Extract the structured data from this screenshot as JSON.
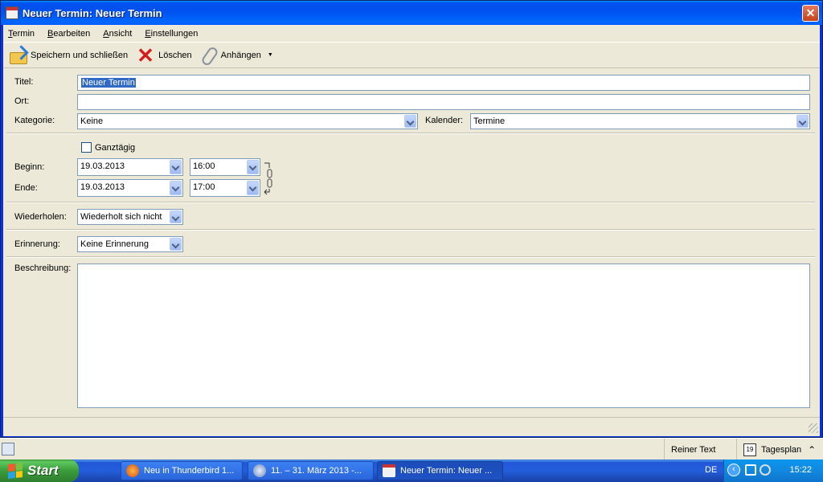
{
  "window": {
    "title": "Neuer Termin: Neuer Termin",
    "close_label": "✕"
  },
  "menu": [
    "Termin",
    "Bearbeiten",
    "Ansicht",
    "Einstellungen"
  ],
  "toolbar": {
    "save_label": "Speichern und schließen",
    "delete_label": "Löschen",
    "attach_label": "Anhängen"
  },
  "form": {
    "title_label": "Titel:",
    "title_value": "Neuer Termin",
    "location_label": "Ort:",
    "location_value": "",
    "category_label": "Kategorie:",
    "category_value": "Keine",
    "calendar_label": "Kalender:",
    "calendar_value": "Termine",
    "allday_label": "Ganztägig",
    "allday_checked": false,
    "start_label": "Beginn:",
    "start_date": "19.03.2013",
    "start_time": "16:00",
    "end_label": "Ende:",
    "end_date": "19.03.2013",
    "end_time": "17:00",
    "repeat_label": "Wiederholen:",
    "repeat_value": "Wiederholt sich nicht",
    "reminder_label": "Erinnerung:",
    "reminder_value": "Keine Erinnerung",
    "description_label": "Beschreibung:",
    "description_value": ""
  },
  "calendar_strip": {
    "plain_text_label": "Reiner Text",
    "agenda_label": "Tagesplan",
    "agenda_icon_day": "19"
  },
  "taskbar": {
    "start_label": "Start",
    "tasks": [
      {
        "label": "Neu in Thunderbird 1...",
        "icon": "firefox-icon",
        "active": false
      },
      {
        "label": "11. – 31. März 2013 -...",
        "icon": "thunderbird-icon",
        "active": false
      },
      {
        "label": "Neuer Termin: Neuer ...",
        "icon": "calendar-icon",
        "active": true
      }
    ],
    "language": "DE",
    "clock": "15:22"
  },
  "colors": {
    "titlebar": "#0054e3",
    "selection": "#316ac5",
    "taskbar": "#245edb",
    "start": "#3a9c3a"
  }
}
